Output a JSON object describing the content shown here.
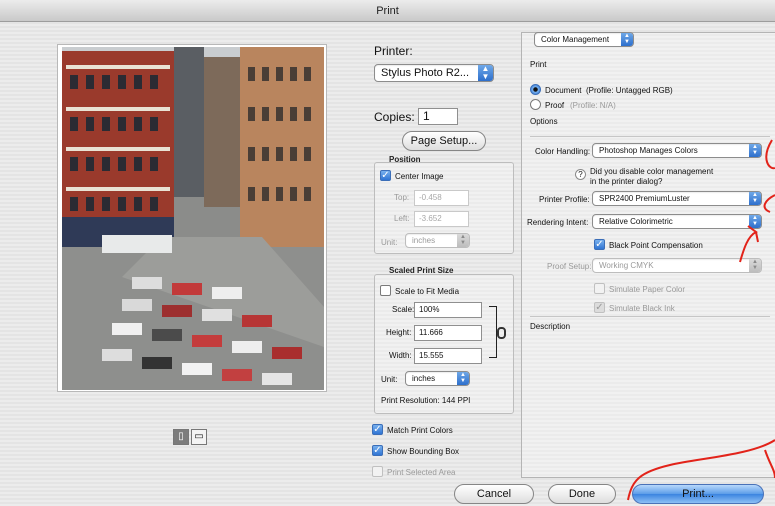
{
  "window": {
    "title": "Print"
  },
  "printer": {
    "label": "Printer:",
    "value": "Stylus Photo R2...",
    "copies_label": "Copies:",
    "copies_value": "1",
    "page_setup": "Page Setup..."
  },
  "position": {
    "title": "Position",
    "center_image": "Center Image",
    "center_checked": true,
    "top_label": "Top:",
    "top_value": "-0.458",
    "left_label": "Left:",
    "left_value": "-3.652",
    "unit_label": "Unit:",
    "unit_value": "inches"
  },
  "scaled": {
    "title": "Scaled Print Size",
    "scale_to_fit": "Scale to Fit Media",
    "scale_label": "Scale:",
    "scale_value": "100%",
    "height_label": "Height:",
    "height_value": "11.666",
    "width_label": "Width:",
    "width_value": "15.555",
    "unit_label": "Unit:",
    "unit_value": "inches",
    "resolution": "Print Resolution: 144 PPI"
  },
  "options_left": {
    "match_colors": "Match Print Colors",
    "bounding_box": "Show Bounding Box",
    "selected_area": "Print Selected Area"
  },
  "color_mgmt": {
    "section_popup": "Color Management",
    "print_label": "Print",
    "document": "Document",
    "document_profile": "(Profile: Untagged RGB)",
    "proof": "Proof",
    "proof_profile": "(Profile: N/A)",
    "options_label": "Options",
    "handling_label": "Color Handling:",
    "handling_value": "Photoshop Manages Colors",
    "help_q1": "Did you disable color management",
    "help_q2": "in the printer dialog?",
    "printer_profile_label": "Printer Profile:",
    "printer_profile_value": "SPR2400 PremiumLuster",
    "intent_label": "Rendering Intent:",
    "intent_value": "Relative Colorimetric",
    "bpc": "Black Point Compensation",
    "proof_setup_label": "Proof Setup:",
    "proof_setup_value": "Working CMYK",
    "simulate_paper": "Simulate Paper Color",
    "simulate_ink": "Simulate Black Ink",
    "description_label": "Description"
  },
  "buttons": {
    "cancel": "Cancel",
    "done": "Done",
    "print": "Print..."
  },
  "icons": {
    "orientation_portrait": "portrait-icon",
    "orientation_landscape": "landscape-icon"
  },
  "colors": {
    "accent_blue": "#3b84e0",
    "annotation_red": "#e2231a"
  }
}
